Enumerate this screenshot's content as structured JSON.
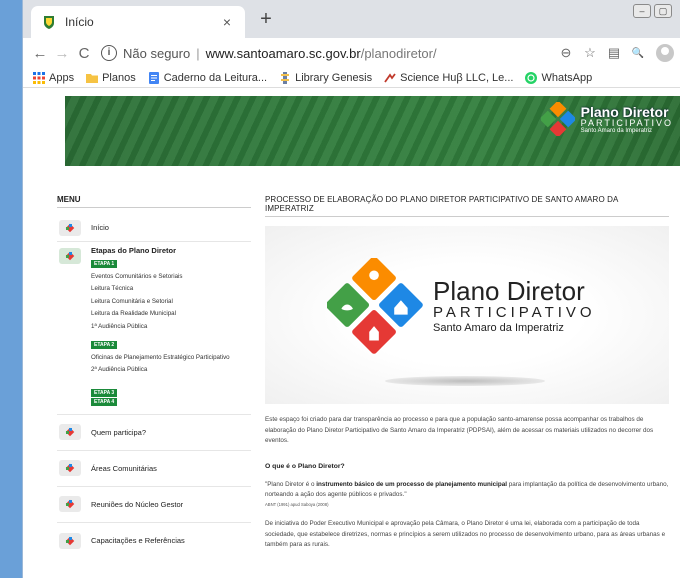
{
  "browser": {
    "tab_title": "Início",
    "tab_close": "×",
    "new_tab": "+",
    "url_insecure": "Não seguro",
    "url_separator": "|",
    "url_host": "www.santoamaro.sc.gov.br",
    "url_path": "/planodiretor/",
    "back": "←",
    "forward": "→",
    "reload": "C",
    "info_glyph": "i",
    "zoom_glyph": "⊖",
    "star_glyph": "☆",
    "doc_glyph": "▤",
    "search_glyph": "🔍",
    "bookmarks": [
      {
        "label": "Apps",
        "icon": "apps-grid-icon"
      },
      {
        "label": "Planos",
        "icon": "folder-icon"
      },
      {
        "label": "Caderno da Leitura...",
        "icon": "docs-icon"
      },
      {
        "label": "Library Genesis",
        "icon": "library-icon"
      },
      {
        "label": "Science Huβ LLC, Le...",
        "icon": "sci-hub-icon"
      },
      {
        "label": "WhatsApp",
        "icon": "whatsapp-icon"
      }
    ]
  },
  "banner": {
    "line1": "Plano Diretor",
    "line2": "PARTICIPATIVO",
    "line3": "Santo Amaro da Imperatriz"
  },
  "menu": {
    "title": "MENU",
    "inicio": "Início",
    "etapas_title": "Etapas do Plano Diretor",
    "etapa1": "ETAPA 1",
    "etapa1_items": [
      "Eventos Comunitários e Setoriais",
      "Leitura Técnica",
      "Leitura Comunitária e Setorial",
      "Leitura da Realidade Municipal",
      "1ª Audiência Pública"
    ],
    "etapa2": "ETAPA 2",
    "etapa2_items": [
      "Oficinas de Planejamento Estratégico Participativo",
      "2ª Audiência Pública"
    ],
    "etapa3": "ETAPA 3",
    "etapa4": "ETAPA 4",
    "quem": "Quem participa?",
    "areas": "Áreas Comunitárias",
    "reunioes": "Reuniões do Núcleo Gestor",
    "capacitacoes": "Capacitações e Referências"
  },
  "content": {
    "title": "PROCESSO DE ELABORAÇÃO DO PLANO DIRETOR PARTICIPATIVO DE SANTO AMARO DA IMPERATRIZ",
    "hero_line1": "Plano Diretor",
    "hero_line2": "PARTICIPATIVO",
    "hero_line3": "Santo Amaro da Imperatriz",
    "intro": "Este espaço foi criado para dar transparência ao processo e para que a população santo-amarense possa acompanhar os trabalhos de elaboração do Plano Diretor Participativo de Santo Amaro da Imperatriz (PDPSAI), além de acessar os materiais utilizados no decorrer dos eventos.",
    "question": "O que é o Plano Diretor?",
    "quote_pre": "\"Plano Diretor é o ",
    "quote_bold": "instrumento básico de um processo de planejamento municipal",
    "quote_post": " para implantação da política de desenvolvimento urbano, norteando a ação dos agente públicos e privados.\"",
    "cite": "ABNT (1991) apud Saboya (2008)",
    "para2": "De iniciativa do Poder Executivo Municipal e aprovação pela Câmara, o Plano Diretor é uma lei, elaborada com a participação de toda sociedade, que estabelece diretrizes, normas e princípios a serem utilizados no processo de desenvolvimento urbano, para as áreas urbanas e também para as rurais."
  },
  "colors": {
    "tab_strip": "#dee1e6",
    "banner_green": "#2f7a3b",
    "badge_green": "#1b8a3a",
    "logo_red": "#e53935",
    "logo_blue": "#1e88e5",
    "logo_green": "#43a047",
    "logo_orange": "#fb8c00"
  }
}
